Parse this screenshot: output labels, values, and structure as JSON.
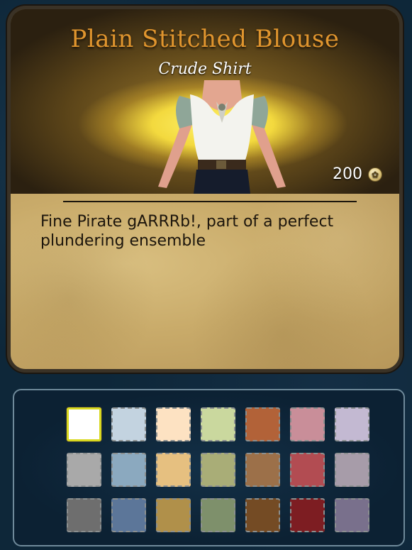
{
  "item": {
    "title": "Plain Stitched Blouse",
    "subtitle": "Crude Shirt",
    "price": "200",
    "price_icon": "coin-icon",
    "description": "Fine Pirate gARRRb!, part of a perfect plundering ensemble"
  },
  "colors": {
    "accent_title": "#e0952e",
    "selected_border": "#d8d81f"
  },
  "swatches": [
    {
      "color": "#ffffff",
      "selected": true
    },
    {
      "color": "#c3d3e0",
      "selected": false
    },
    {
      "color": "#fde2c2",
      "selected": false
    },
    {
      "color": "#cad89e",
      "selected": false
    },
    {
      "color": "#b26238",
      "selected": false
    },
    {
      "color": "#c98e99",
      "selected": false
    },
    {
      "color": "#c3b9d2",
      "selected": false
    },
    {
      "color": "#a9a9a9",
      "selected": false
    },
    {
      "color": "#8ba9bf",
      "selected": false
    },
    {
      "color": "#e6c080",
      "selected": false
    },
    {
      "color": "#a9ad77",
      "selected": false
    },
    {
      "color": "#9c7049",
      "selected": false
    },
    {
      "color": "#b24c52",
      "selected": false
    },
    {
      "color": "#a79ca9",
      "selected": false
    },
    {
      "color": "#6e6e6e",
      "selected": false
    },
    {
      "color": "#5c7699",
      "selected": false
    },
    {
      "color": "#b0904a",
      "selected": false
    },
    {
      "color": "#7e906b",
      "selected": false
    },
    {
      "color": "#744b24",
      "selected": false
    },
    {
      "color": "#7d1d22",
      "selected": false
    },
    {
      "color": "#79708c",
      "selected": false
    }
  ]
}
